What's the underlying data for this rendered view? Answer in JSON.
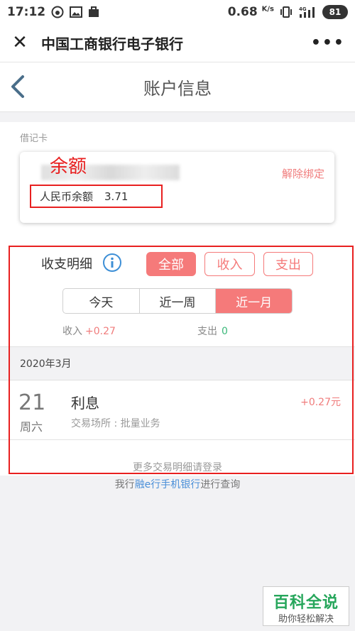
{
  "status_bar": {
    "time": "17:12",
    "speed": "0.68",
    "speed_unit": "K/s",
    "battery": "81",
    "icons": [
      "weibo-icon",
      "gallery-icon",
      "bag-icon",
      "vibrate-icon",
      "signal-4g-icon"
    ]
  },
  "browser": {
    "title": "中国工商银行电子银行",
    "close_icon": "close-icon",
    "more_icon": "more-icon"
  },
  "header": {
    "title": "账户信息",
    "back_icon": "back-icon"
  },
  "card": {
    "type_label": "借记卡",
    "annotation": "余额",
    "unbind_label": "解除绑定",
    "balance_label": "人民币余额",
    "balance_value": "3.71"
  },
  "details": {
    "title": "收支明细",
    "filters": [
      {
        "label": "全部",
        "active": true
      },
      {
        "label": "收入",
        "active": false
      },
      {
        "label": "支出",
        "active": false
      }
    ],
    "periods": [
      {
        "label": "今天",
        "active": false
      },
      {
        "label": "近一周",
        "active": false
      },
      {
        "label": "近一月",
        "active": true
      }
    ],
    "income_label": "收入",
    "income_value": "+0.27",
    "expense_label": "支出",
    "expense_value": "0",
    "month": "2020年3月",
    "transactions": [
      {
        "day": "21",
        "weekday": "周六",
        "name": "利息",
        "place": "交易场所 : 批量业务",
        "amount": "+0.27元"
      }
    ],
    "more_tip": "更多交易明细请登录"
  },
  "query_tip": {
    "prefix": "我行",
    "link": "融e行手机银行",
    "suffix": "进行查询"
  },
  "watermark": {
    "title": "百科全说",
    "subtitle": "助你轻松解决"
  },
  "colors": {
    "accent": "#f57a7a",
    "annotation_red": "#e82020",
    "expense_green": "#3cb87a",
    "link_blue": "#4a8fd8"
  }
}
